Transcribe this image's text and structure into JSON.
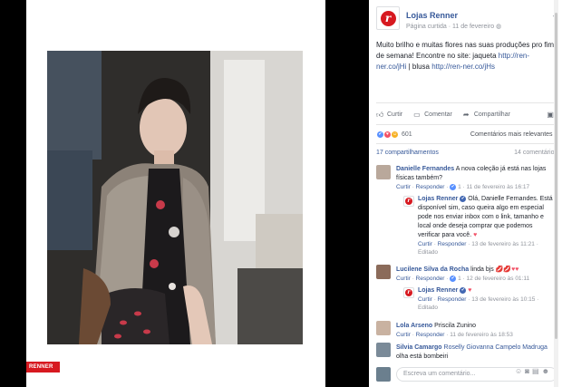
{
  "photo": {
    "brand_tag": "RENNER"
  },
  "post": {
    "page_name": "Lojas Renner",
    "logo_letter": "r",
    "page_type": "Página curtida",
    "date": "11 de fevereiro",
    "text": "Muito brilho e muitas flores nas suas produções pro fim de semana! Encontre no site: jaqueta ",
    "link1": "http://ren-ner.co/jHi",
    "text_mid": " | blusa ",
    "link2": "http://ren-ner.co/jHs"
  },
  "actions": {
    "like": "Curtir",
    "comment": "Comentar",
    "share": "Compartilhar"
  },
  "reactions": {
    "count": "601",
    "sort_label": "Comentários mais relevantes ▾"
  },
  "stats": {
    "shares": "17 compartilhamentos",
    "comments": "14 comentários"
  },
  "comments": [
    {
      "name": "Danielle Fernandes",
      "text": " A nova coleção já está nas lojas físicas também?",
      "meta_like": "Curtir",
      "meta_reply": "Responder",
      "meta_count": "1",
      "meta_date": "11 de fevereiro às 16:17"
    },
    {
      "name": "Lojas Renner",
      "text": " Olá, Danielle Fernandes. Está disponível sim, caso queira algo em especial pode nos enviar inbox com o link, tamanho e local onde deseja comprar que podemos verificar para você. ",
      "meta_like": "Curtir",
      "meta_reply": "Responder",
      "meta_date": "13 de fevereiro às 11:21",
      "meta_edit": "Editado"
    },
    {
      "name": "Lucilene Silva da Rocha",
      "text": " linda bjs ",
      "meta_like": "Curtir",
      "meta_reply": "Responder",
      "meta_count": "1",
      "meta_date": "12 de fevereiro às 01:11"
    },
    {
      "name": "Lojas Renner",
      "text": " ",
      "meta_like": "Curtir",
      "meta_reply": "Responder",
      "meta_date": "13 de fevereiro às 10:15",
      "meta_edit": "Editado"
    },
    {
      "name": "Lola Arseno",
      "text": " Priscila Zunino",
      "meta_like": "Curtir",
      "meta_reply": "Responder",
      "meta_date": "11 de fevereiro às 18:53"
    },
    {
      "name": "Silvia Camargo",
      "text_link": " Roselly Giovanna Campelo Madruga",
      "text": " olha está bombeiri"
    }
  ],
  "compose": {
    "placeholder": "Escreva um comentário..."
  },
  "colors": {
    "link": "#365899",
    "brand": "#d71920"
  }
}
